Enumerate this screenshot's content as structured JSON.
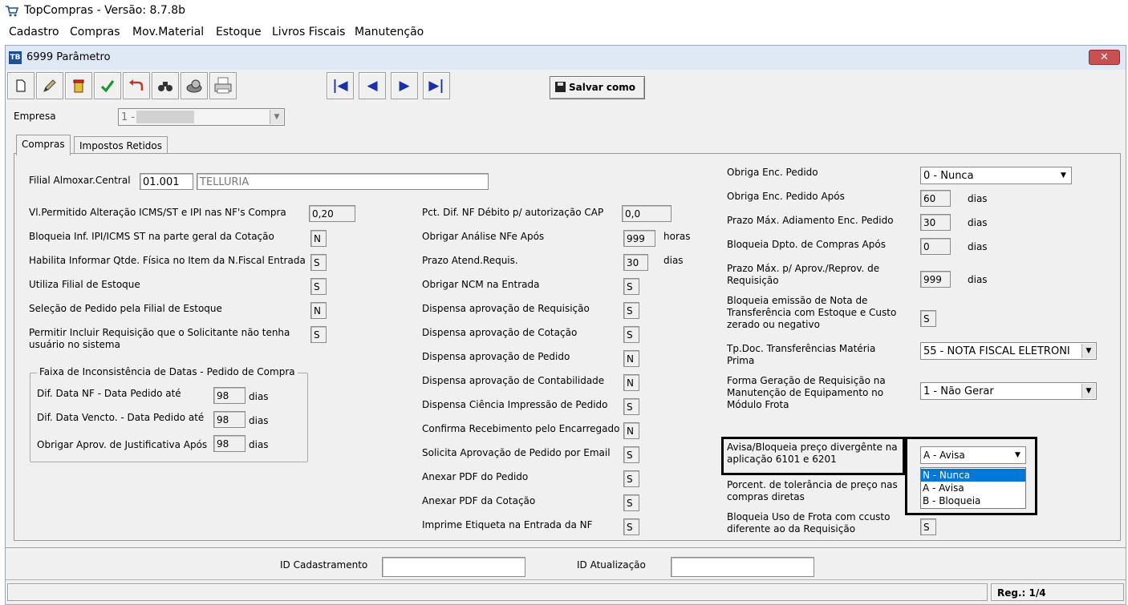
{
  "app": {
    "title": "TopCompras - Versão: 8.7.8b"
  },
  "menu": [
    "Cadastro",
    "Compras",
    "Mov.Material",
    "Estoque",
    "Livros Fiscais",
    "Manutenção"
  ],
  "window": {
    "title": "6999 Parâmetro",
    "icon_text": "TB",
    "close": "✕"
  },
  "toolbar": {
    "icons": [
      "new-document-icon",
      "edit-pencil-icon",
      "delete-trash-icon",
      "confirm-check-icon",
      "undo-arrow-icon",
      "search-binoculars-icon",
      "print-preview-icon",
      "print-icon"
    ],
    "nav": [
      "|◀",
      "◀",
      "▶",
      "▶|"
    ],
    "save_as": "Salvar como"
  },
  "empresa": {
    "label": "Empresa",
    "value": "1 -"
  },
  "tabs": [
    "Compras",
    "Impostos Retidos"
  ],
  "filial": {
    "label": "Filial Almoxar.Central",
    "code": "01.001",
    "name": "TELLURIA"
  },
  "col1": [
    {
      "label": "Vl.Permitido Alteração ICMS/ST e IPI nas NF's Compra",
      "value": "0,20"
    },
    {
      "label": "Bloqueia Inf. IPI/ICMS ST na parte geral da Cotação",
      "value": "N"
    },
    {
      "label": "Habilita Informar Qtde. Física no Item da N.Fiscal Entrada",
      "value": "S"
    },
    {
      "label": "Utiliza Filial de Estoque",
      "value": "S"
    },
    {
      "label": "Seleção de Pedido pela Filial de Estoque",
      "value": "N"
    },
    {
      "label": "Permitir Incluir Requisição que o Solicitante não tenha usuário no sistema",
      "value": "S"
    }
  ],
  "group": {
    "title": "Faixa de Inconsistência de Datas - Pedido de Compra",
    "rows": [
      {
        "label": "Dif. Data NF - Data Pedido até",
        "value": "98",
        "unit": "dias"
      },
      {
        "label": "Dif. Data Vencto. - Data Pedido até",
        "value": "98",
        "unit": "dias"
      },
      {
        "label": "Obrigar Aprov. de Justificativa Após",
        "value": "98",
        "unit": "dias"
      }
    ]
  },
  "col2": [
    {
      "label": "Pct. Dif. NF Débito p/ autorização CAP",
      "value": "0,0",
      "unit": ""
    },
    {
      "label": "Obrigar Análise NFe Após",
      "value": "999",
      "unit": "horas"
    },
    {
      "label": "Prazo Atend.Requis.",
      "value": "30",
      "unit": "dias"
    },
    {
      "label": "Obrigar NCM na Entrada",
      "value": "S",
      "unit": ""
    },
    {
      "label": "Dispensa aprovação de Requisição",
      "value": "S",
      "unit": ""
    },
    {
      "label": "Dispensa aprovação de Cotação",
      "value": "S",
      "unit": ""
    },
    {
      "label": "Dispensa aprovação de Pedido",
      "value": "N",
      "unit": ""
    },
    {
      "label": "Dispensa aprovação de Contabilidade",
      "value": "N",
      "unit": ""
    },
    {
      "label": "Dispensa Ciência Impressão de Pedido",
      "value": "S",
      "unit": ""
    },
    {
      "label": "Confirma Recebimento pelo Encarregado",
      "value": "N",
      "unit": ""
    },
    {
      "label": "Solicita Aprovação de Pedido por Email",
      "value": "S",
      "unit": ""
    },
    {
      "label": "Anexar PDF do Pedido",
      "value": "S",
      "unit": ""
    },
    {
      "label": "Anexar PDF da Cotação",
      "value": "S",
      "unit": ""
    },
    {
      "label": "Imprime Etiqueta na Entrada da NF",
      "value": "S",
      "unit": ""
    }
  ],
  "col3": {
    "obriga_enc": {
      "label": "Obriga Enc. Pedido",
      "value": "0 - Nunca"
    },
    "obriga_enc_apos": {
      "label": "Obriga Enc. Pedido Após",
      "value": "60",
      "unit": "dias"
    },
    "prazo_adiamento": {
      "label": "Prazo Máx. Adiamento Enc. Pedido",
      "value": "30",
      "unit": "dias"
    },
    "bloqueia_dpto": {
      "label": "Bloqueia Dpto. de Compras Após",
      "value": "0",
      "unit": "dias"
    },
    "prazo_aprov": {
      "label": "Prazo Máx. p/ Aprov./Reprov. de Requisição",
      "value": "999",
      "unit": "dias"
    },
    "bloqueia_nota": {
      "label": "Bloqueia emissão de Nota de Transferência com Estoque e Custo zerado ou negativo",
      "value": "S"
    },
    "tpdoc": {
      "label": "Tp.Doc. Transferências Matéria Prima",
      "value": "55 - NOTA FISCAL ELETRONI"
    },
    "forma_geracao": {
      "label": "Forma Geração de Requisição na Manutenção de Equipamento no Módulo Frota",
      "value": "1 - Não Gerar"
    },
    "avisa": {
      "label": "Avisa/Bloqueia preço divergênte na aplicação 6101 e 6201",
      "value": "A - Avisa",
      "options": [
        "N - Nunca",
        "A - Avisa",
        "B - Bloqueia"
      ]
    },
    "porcent": {
      "label": "Porcent. de tolerância de preço nas compras diretas"
    },
    "frota": {
      "label": "Bloqueia Uso de Frota com ccusto diferente ao da Requisição",
      "value": "S"
    }
  },
  "footer": {
    "id_cad_label": "ID Cadastramento",
    "id_cad_value": "",
    "id_atu_label": "ID Atualização",
    "id_atu_value": ""
  },
  "status": {
    "reg": "Reg.: 1/4"
  }
}
